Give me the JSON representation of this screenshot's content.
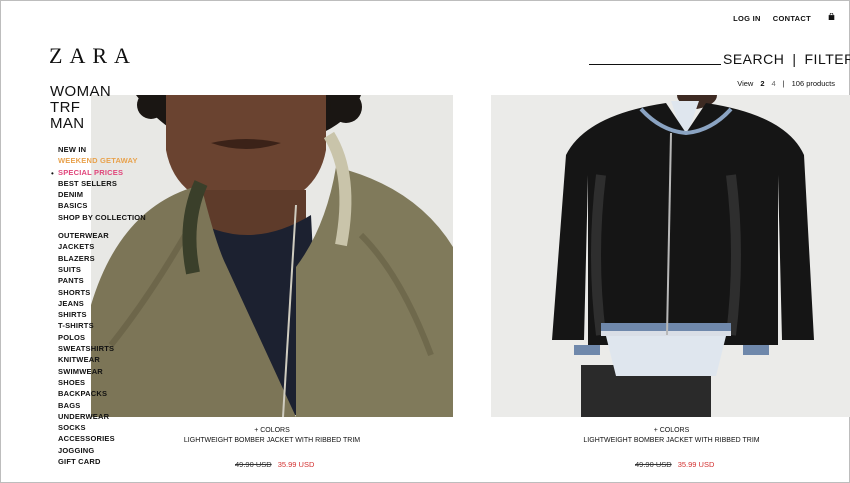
{
  "header": {
    "logo": "ZARA",
    "login": "LOG IN",
    "contact": "CONTACT",
    "search": "SEARCH",
    "separator": "|",
    "filter": "FILTER"
  },
  "view": {
    "label": "View",
    "option_2": "2",
    "option_4": "4",
    "separator": "|",
    "count": "106 products"
  },
  "sections": [
    "WOMAN",
    "TRF",
    "MAN"
  ],
  "nav": {
    "group1": [
      "NEW IN",
      "WEEKEND GETAWAY",
      "SPECIAL PRICES",
      "BEST SELLERS",
      "DENIM",
      "BASICS",
      "SHOP BY COLLECTION"
    ],
    "group2": [
      "OUTERWEAR",
      "JACKETS",
      "BLAZERS",
      "SUITS",
      "PANTS",
      "SHORTS",
      "JEANS",
      "SHIRTS",
      "T-SHIRTS",
      "POLOS",
      "SWEATSHIRTS",
      "KNITWEAR",
      "SWIMWEAR",
      "SHOES",
      "BACKPACKS",
      "BAGS",
      "UNDERWEAR",
      "SOCKS",
      "ACCESSORIES",
      "JOGGING",
      "GIFT CARD"
    ]
  },
  "products": [
    {
      "colors": "+ COLORS",
      "name": "LIGHTWEIGHT BOMBER JACKET WITH RIBBED TRIM",
      "old_price": "49.90 USD",
      "price": "35.99 USD"
    },
    {
      "colors": "+ COLORS",
      "name": "LIGHTWEIGHT BOMBER JACKET WITH RIBBED TRIM",
      "old_price": "49.90 USD",
      "price": "35.99 USD"
    }
  ],
  "colors": {
    "accent_orange": "#e8a24d",
    "accent_pink": "#e0457b",
    "sale_red": "#d3302f"
  },
  "icons": [
    "bag-icon"
  ]
}
